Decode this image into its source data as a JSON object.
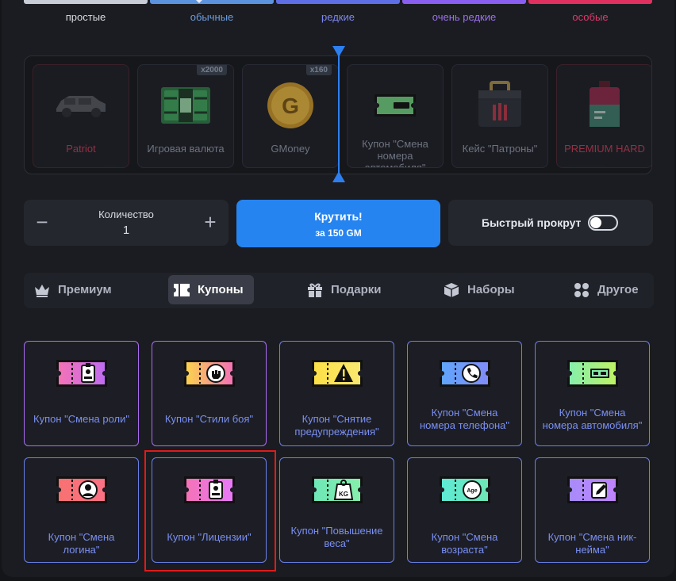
{
  "rarity": [
    {
      "label": "простые",
      "color": "#c8ccd6",
      "text": "#d9dce3"
    },
    {
      "label": "обычные",
      "color": "#5b93de",
      "text": "#6d9ddf"
    },
    {
      "label": "редкие",
      "color": "#5e6fe6",
      "text": "#7c86f0"
    },
    {
      "label": "очень редкие",
      "color": "#8a5ef0",
      "text": "#9b70f0"
    },
    {
      "label": "особые",
      "color": "#e0305f",
      "text": "#e0386a"
    }
  ],
  "roulette": {
    "items": [
      {
        "name": "Patriot",
        "color": "#c43b55"
      },
      {
        "name": "Игровая валюта",
        "badge": "x2000",
        "color": "#8f96a6"
      },
      {
        "name": "GMoney",
        "badge": "x160",
        "color": "#8f96a6"
      },
      {
        "name": "Купон \"Смена номера автомобиля\"",
        "color": "#8f96a6"
      },
      {
        "name": "Кейс \"Патроны\"",
        "color": "#8f96a6"
      },
      {
        "name": "PREMIUM HARD",
        "color": "#c43b55"
      }
    ]
  },
  "controls": {
    "quantity_label": "Количество",
    "quantity_value": "1",
    "minus": "−",
    "plus": "+",
    "spin_label": "Крутить!",
    "spin_price": "за 150 GM",
    "fast_label": "Быстрый прокрут"
  },
  "tabs": [
    {
      "label": "Премиум",
      "icon": "crown-icon"
    },
    {
      "label": "Купоны",
      "icon": "coupon-icon",
      "active": true
    },
    {
      "label": "Подарки",
      "icon": "gift-icon"
    },
    {
      "label": "Наборы",
      "icon": "box-icon"
    },
    {
      "label": "Другое",
      "icon": "grid-dots-icon"
    }
  ],
  "coupons": [
    {
      "name": "Купон \"Смена роли\"",
      "icon": "badge-icon",
      "colors": [
        "#f472b6",
        "#c06cf0"
      ]
    },
    {
      "name": "Купон \"Стили боя\"",
      "icon": "fist-icon",
      "colors": [
        "#fcd34d",
        "#f472b6"
      ]
    },
    {
      "name": "Купон \"Снятие предупреждения\"",
      "icon": "warning-icon",
      "colors": [
        "#fde047",
        "#f9e870"
      ]
    },
    {
      "name": "Купон \"Смена номера телефона\"",
      "icon": "phone-icon",
      "colors": [
        "#60a5fa",
        "#818cf8"
      ]
    },
    {
      "name": "Купон \"Смена номера автомобиля\"",
      "icon": "plate-icon",
      "colors": [
        "#86efac",
        "#bef264"
      ]
    },
    {
      "name": "Купон \"Смена логина\"",
      "icon": "user-icon",
      "colors": [
        "#f87171",
        "#fb7185"
      ]
    },
    {
      "name": "Купон \"Лицензии\"",
      "icon": "license-icon",
      "colors": [
        "#f472b6",
        "#e879f9"
      ]
    },
    {
      "name": "Купон \"Повышение веса\"",
      "icon": "weight-icon",
      "colors": [
        "#6ee7b7",
        "#86efac"
      ]
    },
    {
      "name": "Купон \"Смена возраста\"",
      "icon": "age-icon",
      "colors": [
        "#5eead4",
        "#6ee7b7"
      ]
    },
    {
      "name": "Купон \"Смена ник-нейма\"",
      "icon": "edit-icon",
      "colors": [
        "#a78bfa",
        "#c084fc"
      ]
    }
  ]
}
